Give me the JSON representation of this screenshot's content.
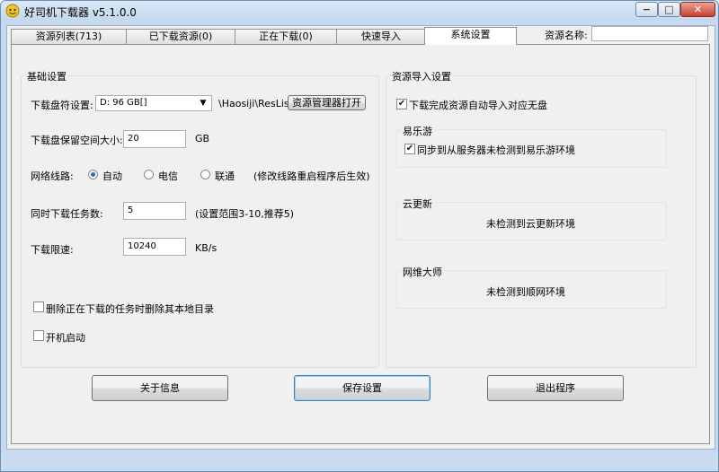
{
  "window": {
    "title": "好司机下载器 v5.1.0.0",
    "controls": {
      "minimize": "−",
      "maximize": "□",
      "close": "✕"
    }
  },
  "tabs": [
    {
      "label": "资源列表(713)",
      "active": false
    },
    {
      "label": "已下载资源(0)",
      "active": false
    },
    {
      "label": "正在下载(0)",
      "active": false
    },
    {
      "label": "快速导入",
      "active": false
    },
    {
      "label": "系统设置",
      "active": true
    }
  ],
  "resource_name": {
    "label": "资源名称:",
    "value": ""
  },
  "basic": {
    "legend": "基础设置",
    "drive_label": "下载盘符设置:",
    "drive_value": "D: 96 GB[]",
    "path_text": "\\Haosiji\\ResList",
    "open_button": "资源管理器打开",
    "reserve_label": "下载盘保留空间大小:",
    "reserve_value": "20",
    "reserve_unit": "GB",
    "network_label": "网络线路:",
    "network_options": [
      "自动",
      "电信",
      "联通"
    ],
    "network_selected": "自动",
    "network_note": "(修改线路重启程序后生效)",
    "tasks_label": "同时下载任务数:",
    "tasks_value": "5",
    "tasks_note": "(设置范围3-10,推荐5)",
    "speed_label": "下载限速:",
    "speed_value": "10240",
    "speed_unit": "KB/s",
    "delete_dir_label": "删除正在下载的任务时删除其本地目录",
    "delete_dir_checked": false,
    "autostart_label": "开机启动",
    "autostart_checked": false
  },
  "import": {
    "legend": "资源导入设置",
    "auto_import_label": "下载完成资源自动导入对应无盘",
    "auto_import_checked": true,
    "yile": {
      "title": "易乐游",
      "sync_label": "同步到从服务器",
      "sync_checked": true,
      "status": "未检测到易乐游环境"
    },
    "yun": {
      "title": "云更新",
      "status": "未检测到云更新环境"
    },
    "wangwei": {
      "title": "网维大师",
      "status": "未检测到顺网环境"
    }
  },
  "buttons": {
    "about": "关于信息",
    "save": "保存设置",
    "exit": "退出程序"
  }
}
